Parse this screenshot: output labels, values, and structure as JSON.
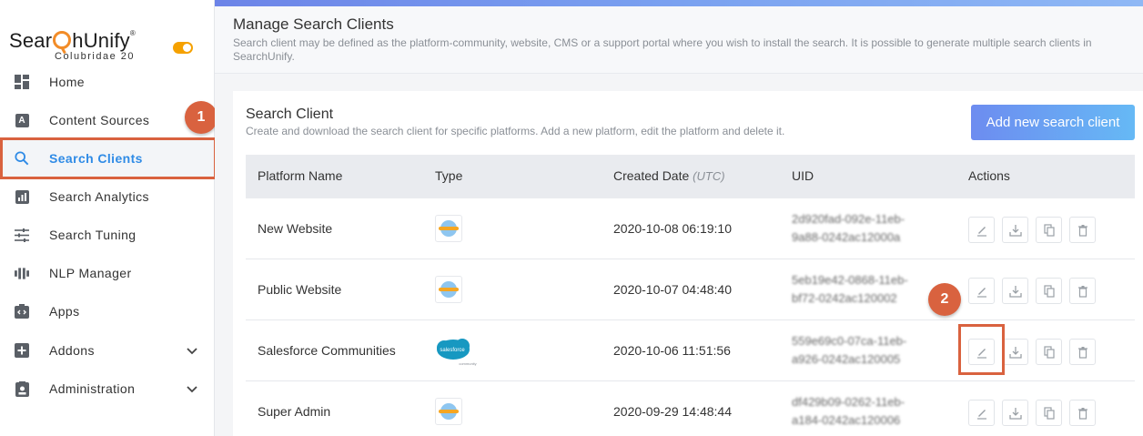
{
  "brand": {
    "logo_text_left": "Sear",
    "logo_text_right": "hUnify",
    "logo_mark": "®",
    "version": "Colubridae 20"
  },
  "sidebar": {
    "items": [
      {
        "label": "Home",
        "icon": "dashboard-icon"
      },
      {
        "label": "Content Sources",
        "icon": "content-sources-icon"
      },
      {
        "label": "Search Clients",
        "icon": "search-icon",
        "active": true
      },
      {
        "label": "Search Analytics",
        "icon": "analytics-icon"
      },
      {
        "label": "Search Tuning",
        "icon": "tuning-icon"
      },
      {
        "label": "NLP Manager",
        "icon": "nlp-icon"
      },
      {
        "label": "Apps",
        "icon": "apps-icon"
      },
      {
        "label": "Addons",
        "icon": "addons-icon",
        "expandable": true
      },
      {
        "label": "Administration",
        "icon": "administration-icon",
        "expandable": true
      }
    ]
  },
  "header": {
    "title": "Manage Search Clients",
    "description": "Search client may be defined as the platform-community, website, CMS or a support portal where you wish to install the search. It is possible to generate multiple search clients in SearchUnify."
  },
  "card": {
    "title": "Search Client",
    "description": "Create and download the search client for specific platforms. Add a new platform, edit the platform and delete it.",
    "add_button": "Add new search client"
  },
  "table": {
    "headers": {
      "name": "Platform Name",
      "type": "Type",
      "created": "Created Date",
      "created_unit": "(UTC)",
      "uid": "UID",
      "actions": "Actions"
    },
    "rows": [
      {
        "name": "New Website",
        "type": "website",
        "created": "2020-10-08 06:19:10",
        "uid_line1": "2d920fad-092e-11eb-",
        "uid_line2": "9a88-0242ac12000a"
      },
      {
        "name": "Public Website",
        "type": "website",
        "created": "2020-10-07 04:48:40",
        "uid_line1": "5eb19e42-0868-11eb-",
        "uid_line2": "bf72-0242ac120002"
      },
      {
        "name": "Salesforce Communities",
        "type": "salesforce",
        "created": "2020-10-06 11:51:56",
        "uid_line1": "559e69c0-07ca-11eb-",
        "uid_line2": "a926-0242ac120005"
      },
      {
        "name": "Super Admin",
        "type": "website",
        "created": "2020-09-29 14:48:44",
        "uid_line1": "df429b09-0262-11eb-",
        "uid_line2": "a184-0242ac120006"
      }
    ],
    "action_icons": [
      "edit-icon",
      "download-icon",
      "copy-icon",
      "delete-icon"
    ]
  },
  "annotations": {
    "step1": "1",
    "step2": "2"
  },
  "colors": {
    "accent": "#2f8be6",
    "annotation": "#d9623f",
    "toggle": "#f5a100",
    "logo": "#f28c28"
  }
}
